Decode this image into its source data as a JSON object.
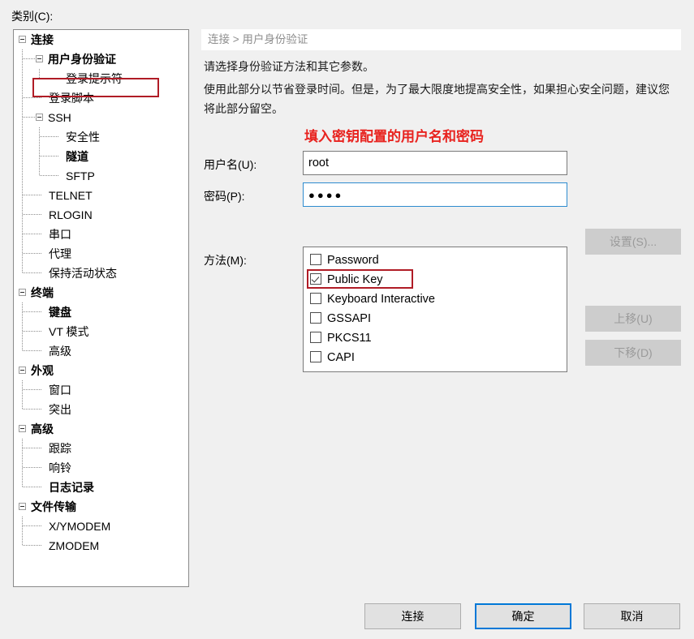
{
  "category_label": "类别(C):",
  "tree": {
    "items": [
      {
        "label": "连接",
        "depth": 0,
        "bold": true,
        "expander": true
      },
      {
        "label": "用户身份验证",
        "depth": 1,
        "bold": true,
        "expander": true,
        "highlighted": true
      },
      {
        "label": "登录提示符",
        "depth": 2,
        "bold": false,
        "expander": false
      },
      {
        "label": "登录脚本",
        "depth": 1,
        "bold": false,
        "expander": false
      },
      {
        "label": "SSH",
        "depth": 1,
        "bold": false,
        "expander": true
      },
      {
        "label": "安全性",
        "depth": 2,
        "bold": false,
        "expander": false
      },
      {
        "label": "隧道",
        "depth": 2,
        "bold": true,
        "expander": false
      },
      {
        "label": "SFTP",
        "depth": 2,
        "bold": false,
        "expander": false
      },
      {
        "label": "TELNET",
        "depth": 1,
        "bold": false,
        "expander": false
      },
      {
        "label": "RLOGIN",
        "depth": 1,
        "bold": false,
        "expander": false
      },
      {
        "label": "串口",
        "depth": 1,
        "bold": false,
        "expander": false
      },
      {
        "label": "代理",
        "depth": 1,
        "bold": false,
        "expander": false
      },
      {
        "label": "保持活动状态",
        "depth": 1,
        "bold": false,
        "expander": false
      },
      {
        "label": "终端",
        "depth": 0,
        "bold": true,
        "expander": true
      },
      {
        "label": "键盘",
        "depth": 1,
        "bold": true,
        "expander": false
      },
      {
        "label": "VT 模式",
        "depth": 1,
        "bold": false,
        "expander": false
      },
      {
        "label": "高级",
        "depth": 1,
        "bold": false,
        "expander": false
      },
      {
        "label": "外观",
        "depth": 0,
        "bold": true,
        "expander": true
      },
      {
        "label": "窗口",
        "depth": 1,
        "bold": false,
        "expander": false
      },
      {
        "label": "突出",
        "depth": 1,
        "bold": false,
        "expander": false
      },
      {
        "label": "高级",
        "depth": 0,
        "bold": true,
        "expander": true
      },
      {
        "label": "跟踪",
        "depth": 1,
        "bold": false,
        "expander": false
      },
      {
        "label": "响铃",
        "depth": 1,
        "bold": false,
        "expander": false
      },
      {
        "label": "日志记录",
        "depth": 1,
        "bold": true,
        "expander": false
      },
      {
        "label": "文件传输",
        "depth": 0,
        "bold": true,
        "expander": true
      },
      {
        "label": "X/YMODEM",
        "depth": 1,
        "bold": false,
        "expander": false
      },
      {
        "label": "ZMODEM",
        "depth": 1,
        "bold": false,
        "expander": false
      }
    ]
  },
  "right_pane": {
    "breadcrumb": "连接 > 用户身份验证",
    "description_line1": "请选择身份验证方法和其它参数。",
    "description_line2": "使用此部分以节省登录时间。但是，为了最大限度地提高安全性，如果担心安全问题，建议您将此部分留空。",
    "red_note": "填入密钥配置的用户名和密码",
    "username": {
      "label": "用户名(U):",
      "value": "root",
      "placeholder": ""
    },
    "password": {
      "label": "密码(P):",
      "value": "●●●●",
      "placeholder": ""
    },
    "methods": {
      "label": "方法(M):",
      "items": [
        {
          "label": "Password",
          "checked": false
        },
        {
          "label": "Public Key",
          "checked": true,
          "highlighted": true
        },
        {
          "label": "Keyboard Interactive",
          "checked": false
        },
        {
          "label": "GSSAPI",
          "checked": false
        },
        {
          "label": "PKCS11",
          "checked": false
        },
        {
          "label": "CAPI",
          "checked": false
        }
      ]
    },
    "side_buttons": [
      {
        "label": "设置(S)...",
        "disabled": true
      },
      {
        "label": "上移(U)",
        "disabled": true
      },
      {
        "label": "下移(D)",
        "disabled": true
      }
    ]
  },
  "footer": {
    "connect_label": "连接",
    "ok_label": "确定",
    "cancel_label": "取消"
  },
  "colors": {
    "annotation_red": "#b01c26",
    "note_red": "#e8231f",
    "focus_blue": "#0078d7",
    "input_focus_blue": "#2e8ccf",
    "window_bg": "#f0f0f0",
    "panel_bg": "#ffffff",
    "disabled_btn_bg": "#cdcdcd",
    "disabled_btn_fg": "#9a9a9a"
  }
}
